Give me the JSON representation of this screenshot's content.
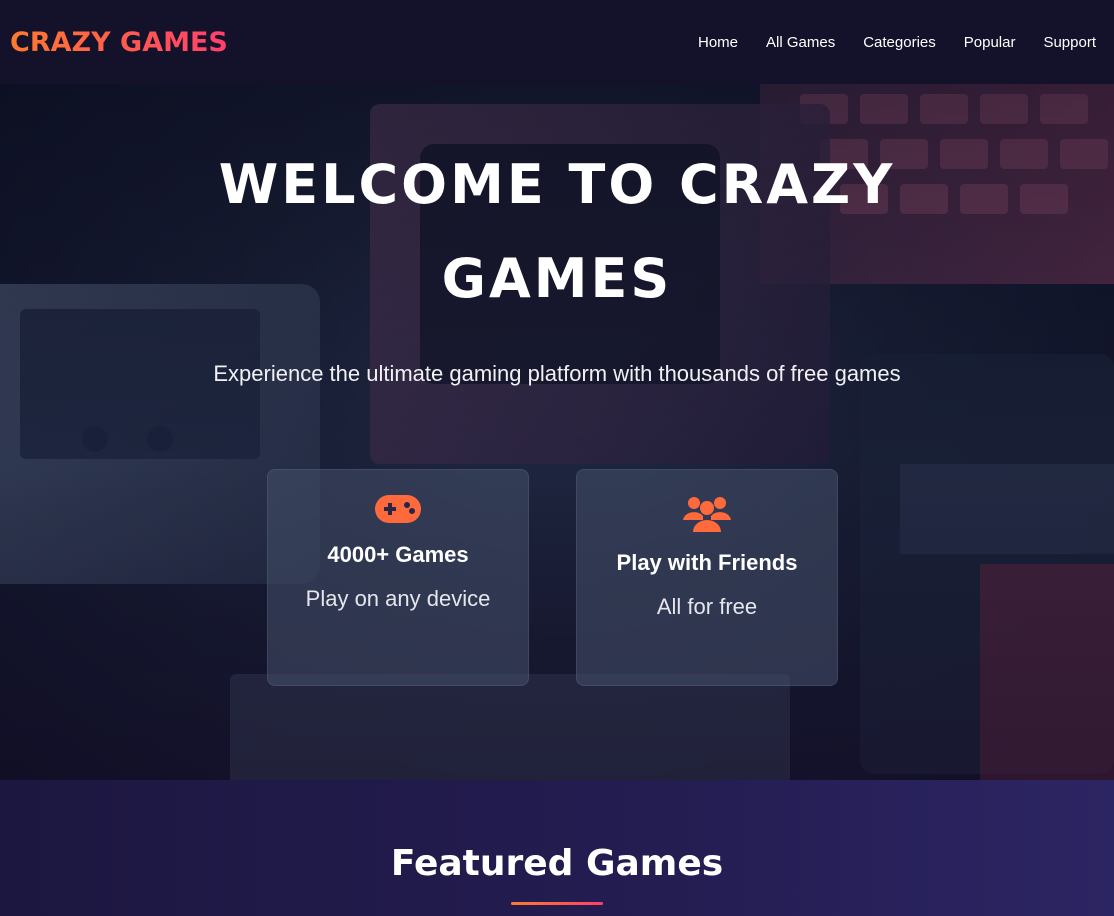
{
  "brand": {
    "logo_text": "CRAZY GAMES",
    "accent_start": "#ff7a2e",
    "accent_end": "#ff3f6c"
  },
  "nav": {
    "items": [
      {
        "label": "Home"
      },
      {
        "label": "All Games"
      },
      {
        "label": "Categories"
      },
      {
        "label": "Popular"
      },
      {
        "label": "Support"
      }
    ]
  },
  "hero": {
    "title": "WELCOME TO CRAZY GAMES",
    "subtitle": "Experience the ultimate gaming platform with thousands of free games",
    "cards": [
      {
        "icon": "gamepad-icon",
        "title": "4000+ Games",
        "text": "Play on any device"
      },
      {
        "icon": "users-icon",
        "title": "Play with Friends",
        "text": "All for free"
      }
    ]
  },
  "featured": {
    "title": "Featured Games"
  },
  "colors": {
    "nav_bg": "#14112b",
    "section_bg": "#241d52",
    "icon_color": "#ff6a3d"
  }
}
